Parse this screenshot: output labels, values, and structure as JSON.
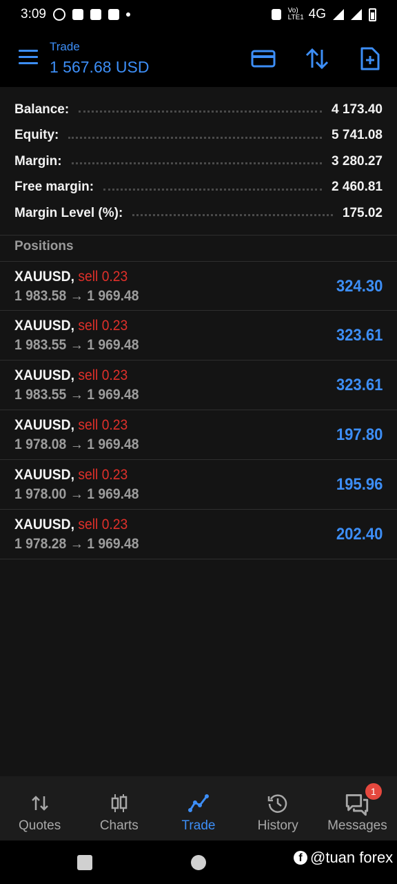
{
  "status_bar": {
    "time": "3:09",
    "network": "4G",
    "volte": "Vo) LTE1"
  },
  "header": {
    "title": "Trade",
    "subtitle": "1 567.68 USD"
  },
  "summary": [
    {
      "label": "Balance:",
      "value": "4 173.40"
    },
    {
      "label": "Equity:",
      "value": "5 741.08"
    },
    {
      "label": "Margin:",
      "value": "3 280.27"
    },
    {
      "label": "Free margin:",
      "value": "2 460.81"
    },
    {
      "label": "Margin Level (%):",
      "value": "175.02"
    }
  ],
  "positions_title": "Positions",
  "positions": [
    {
      "symbol": "XAUUSD,",
      "side": "sell 0.23",
      "prices": "1 983.58 → 1 969.48",
      "profit": "324.30"
    },
    {
      "symbol": "XAUUSD,",
      "side": "sell 0.23",
      "prices": "1 983.55 → 1 969.48",
      "profit": "323.61"
    },
    {
      "symbol": "XAUUSD,",
      "side": "sell 0.23",
      "prices": "1 983.55 → 1 969.48",
      "profit": "323.61"
    },
    {
      "symbol": "XAUUSD,",
      "side": "sell 0.23",
      "prices": "1 978.08 → 1 969.48",
      "profit": "197.80"
    },
    {
      "symbol": "XAUUSD,",
      "side": "sell 0.23",
      "prices": "1 978.00 → 1 969.48",
      "profit": "195.96"
    },
    {
      "symbol": "XAUUSD,",
      "side": "sell 0.23",
      "prices": "1 978.28 → 1 969.48",
      "profit": "202.40"
    }
  ],
  "bottom_nav": [
    {
      "label": "Quotes",
      "icon": "quotes-arrows-icon"
    },
    {
      "label": "Charts",
      "icon": "candlestick-icon"
    },
    {
      "label": "Trade",
      "icon": "trade-line-icon",
      "active": true
    },
    {
      "label": "History",
      "icon": "history-clock-icon"
    },
    {
      "label": "Messages",
      "icon": "messages-icon",
      "badge": "1"
    }
  ],
  "watermark": "@tuan forex",
  "colors": {
    "accent": "#3d8ef6",
    "sell": "#e0302a",
    "background": "#141414",
    "badge": "#e5483e"
  }
}
